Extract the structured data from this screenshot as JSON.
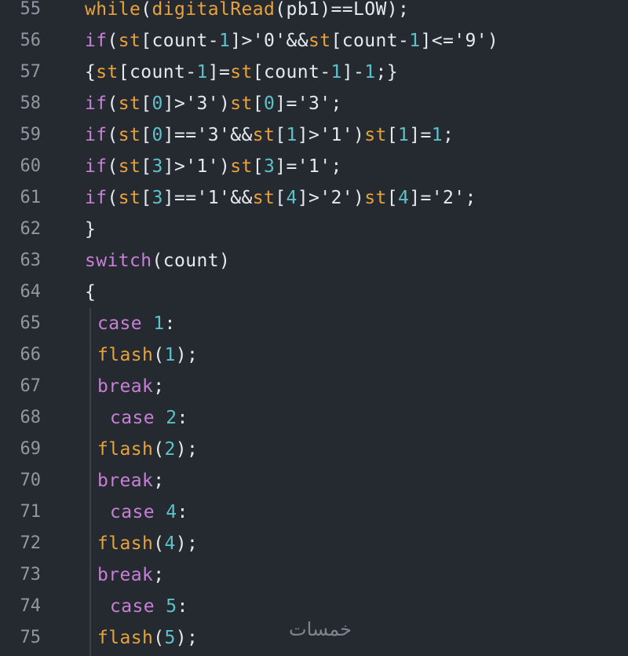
{
  "editor": {
    "background": "#252a30",
    "colors": {
      "keyword": "#c97fd6",
      "function": "#e9a23b",
      "number": "#5bc2cc",
      "text": "#e6e9ee",
      "line_number": "#9098a3"
    },
    "lines": [
      {
        "num": "55",
        "indent": 0,
        "tokens": [
          {
            "t": "while",
            "c": "fn"
          },
          {
            "t": "(",
            "c": "pl"
          },
          {
            "t": "digitalRead",
            "c": "fn"
          },
          {
            "t": "(pb",
            "c": "pl"
          },
          {
            "t": "1",
            "c": "pl"
          },
          {
            "t": ")==LOW);",
            "c": "pl"
          }
        ]
      },
      {
        "num": "56",
        "indent": 0,
        "tokens": [
          {
            "t": "if",
            "c": "kw"
          },
          {
            "t": "(",
            "c": "pl"
          },
          {
            "t": "st",
            "c": "fn"
          },
          {
            "t": "[count-",
            "c": "pl"
          },
          {
            "t": "1",
            "c": "num"
          },
          {
            "t": "]>'0'&&",
            "c": "pl"
          },
          {
            "t": "st",
            "c": "fn"
          },
          {
            "t": "[count-",
            "c": "pl"
          },
          {
            "t": "1",
            "c": "num"
          },
          {
            "t": "]<='9')",
            "c": "pl"
          }
        ]
      },
      {
        "num": "57",
        "indent": 0,
        "tokens": [
          {
            "t": "{",
            "c": "pl"
          },
          {
            "t": "st",
            "c": "fn"
          },
          {
            "t": "[count-",
            "c": "pl"
          },
          {
            "t": "1",
            "c": "num"
          },
          {
            "t": "]=",
            "c": "pl"
          },
          {
            "t": "st",
            "c": "fn"
          },
          {
            "t": "[count-",
            "c": "pl"
          },
          {
            "t": "1",
            "c": "num"
          },
          {
            "t": "]-",
            "c": "pl"
          },
          {
            "t": "1",
            "c": "num"
          },
          {
            "t": ";}",
            "c": "pl"
          }
        ]
      },
      {
        "num": "58",
        "indent": 0,
        "tokens": [
          {
            "t": "if",
            "c": "kw"
          },
          {
            "t": "(",
            "c": "pl"
          },
          {
            "t": "st",
            "c": "fn"
          },
          {
            "t": "[",
            "c": "pl"
          },
          {
            "t": "0",
            "c": "num"
          },
          {
            "t": "]>'3')",
            "c": "pl"
          },
          {
            "t": "st",
            "c": "fn"
          },
          {
            "t": "[",
            "c": "pl"
          },
          {
            "t": "0",
            "c": "num"
          },
          {
            "t": "]='3';",
            "c": "pl"
          }
        ]
      },
      {
        "num": "59",
        "indent": 0,
        "tokens": [
          {
            "t": "if",
            "c": "kw"
          },
          {
            "t": "(",
            "c": "pl"
          },
          {
            "t": "st",
            "c": "fn"
          },
          {
            "t": "[",
            "c": "pl"
          },
          {
            "t": "0",
            "c": "num"
          },
          {
            "t": "]=='3'&&",
            "c": "pl"
          },
          {
            "t": "st",
            "c": "fn"
          },
          {
            "t": "[",
            "c": "pl"
          },
          {
            "t": "1",
            "c": "num"
          },
          {
            "t": "]>'1')",
            "c": "pl"
          },
          {
            "t": "st",
            "c": "fn"
          },
          {
            "t": "[",
            "c": "pl"
          },
          {
            "t": "1",
            "c": "num"
          },
          {
            "t": "]=",
            "c": "pl"
          },
          {
            "t": "1",
            "c": "num"
          },
          {
            "t": ";",
            "c": "pl"
          }
        ]
      },
      {
        "num": "60",
        "indent": 0,
        "tokens": [
          {
            "t": "if",
            "c": "kw"
          },
          {
            "t": "(",
            "c": "pl"
          },
          {
            "t": "st",
            "c": "fn"
          },
          {
            "t": "[",
            "c": "pl"
          },
          {
            "t": "3",
            "c": "num"
          },
          {
            "t": "]>'1')",
            "c": "pl"
          },
          {
            "t": "st",
            "c": "fn"
          },
          {
            "t": "[",
            "c": "pl"
          },
          {
            "t": "3",
            "c": "num"
          },
          {
            "t": "]='1';",
            "c": "pl"
          }
        ]
      },
      {
        "num": "61",
        "indent": 0,
        "tokens": [
          {
            "t": "if",
            "c": "kw"
          },
          {
            "t": "(",
            "c": "pl"
          },
          {
            "t": "st",
            "c": "fn"
          },
          {
            "t": "[",
            "c": "pl"
          },
          {
            "t": "3",
            "c": "num"
          },
          {
            "t": "]=='1'&&",
            "c": "pl"
          },
          {
            "t": "st",
            "c": "fn"
          },
          {
            "t": "[",
            "c": "pl"
          },
          {
            "t": "4",
            "c": "num"
          },
          {
            "t": "]>'2')",
            "c": "pl"
          },
          {
            "t": "st",
            "c": "fn"
          },
          {
            "t": "[",
            "c": "pl"
          },
          {
            "t": "4",
            "c": "num"
          },
          {
            "t": "]='2';",
            "c": "pl"
          }
        ]
      },
      {
        "num": "62",
        "indent": 0,
        "tokens": [
          {
            "t": "}",
            "c": "pl"
          }
        ]
      },
      {
        "num": "63",
        "indent": 0,
        "tokens": [
          {
            "t": "switch",
            "c": "kw"
          },
          {
            "t": "(count)",
            "c": "pl"
          }
        ]
      },
      {
        "num": "64",
        "indent": 0,
        "tokens": [
          {
            "t": "{",
            "c": "pl"
          }
        ]
      },
      {
        "num": "65",
        "indent": 1,
        "tokens": [
          {
            "t": "case",
            "c": "kw"
          },
          {
            "t": " ",
            "c": "pl"
          },
          {
            "t": "1",
            "c": "num"
          },
          {
            "t": ":",
            "c": "pl"
          }
        ]
      },
      {
        "num": "66",
        "indent": 1,
        "tokens": [
          {
            "t": "flash",
            "c": "fn"
          },
          {
            "t": "(",
            "c": "pl"
          },
          {
            "t": "1",
            "c": "num"
          },
          {
            "t": ");",
            "c": "pl"
          }
        ]
      },
      {
        "num": "67",
        "indent": 1,
        "tokens": [
          {
            "t": "break",
            "c": "kw"
          },
          {
            "t": ";",
            "c": "pl"
          }
        ]
      },
      {
        "num": "68",
        "indent": 2,
        "tokens": [
          {
            "t": "case",
            "c": "kw"
          },
          {
            "t": " ",
            "c": "pl"
          },
          {
            "t": "2",
            "c": "num"
          },
          {
            "t": ":",
            "c": "pl"
          }
        ]
      },
      {
        "num": "69",
        "indent": 1,
        "tokens": [
          {
            "t": "flash",
            "c": "fn"
          },
          {
            "t": "(",
            "c": "pl"
          },
          {
            "t": "2",
            "c": "num"
          },
          {
            "t": ");",
            "c": "pl"
          }
        ]
      },
      {
        "num": "70",
        "indent": 1,
        "tokens": [
          {
            "t": "break",
            "c": "kw"
          },
          {
            "t": ";",
            "c": "pl"
          }
        ]
      },
      {
        "num": "71",
        "indent": 2,
        "tokens": [
          {
            "t": "case",
            "c": "kw"
          },
          {
            "t": " ",
            "c": "pl"
          },
          {
            "t": "4",
            "c": "num"
          },
          {
            "t": ":",
            "c": "pl"
          }
        ]
      },
      {
        "num": "72",
        "indent": 1,
        "tokens": [
          {
            "t": "flash",
            "c": "fn"
          },
          {
            "t": "(",
            "c": "pl"
          },
          {
            "t": "4",
            "c": "num"
          },
          {
            "t": ");",
            "c": "pl"
          }
        ]
      },
      {
        "num": "73",
        "indent": 1,
        "tokens": [
          {
            "t": "break",
            "c": "kw"
          },
          {
            "t": ";",
            "c": "pl"
          }
        ]
      },
      {
        "num": "74",
        "indent": 2,
        "tokens": [
          {
            "t": "case",
            "c": "kw"
          },
          {
            "t": " ",
            "c": "pl"
          },
          {
            "t": "5",
            "c": "num"
          },
          {
            "t": ":",
            "c": "pl"
          }
        ]
      },
      {
        "num": "75",
        "indent": 1,
        "tokens": [
          {
            "t": "flash",
            "c": "fn"
          },
          {
            "t": "(",
            "c": "pl"
          },
          {
            "t": "5",
            "c": "num"
          },
          {
            "t": ");",
            "c": "pl"
          }
        ]
      }
    ]
  },
  "watermark": {
    "text": "خمسات"
  }
}
